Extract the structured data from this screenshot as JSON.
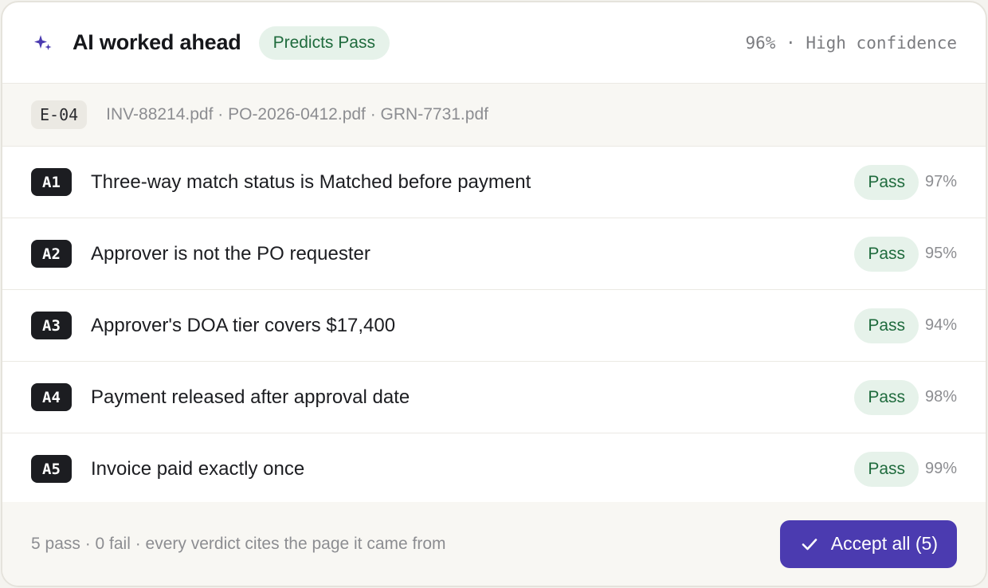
{
  "header": {
    "icon": "sparkle-icon",
    "title": "AI worked ahead",
    "badge": "Predicts Pass",
    "confidence": "96% · High confidence"
  },
  "evidence": {
    "id": "E-04",
    "files": "INV-88214.pdf · PO-2026-0412.pdf · GRN-7731.pdf"
  },
  "checks": [
    {
      "id": "A1",
      "text": "Three-way match status is Matched before payment",
      "verdict": "Pass",
      "pct": "97%"
    },
    {
      "id": "A2",
      "text": "Approver is not the PO requester",
      "verdict": "Pass",
      "pct": "95%"
    },
    {
      "id": "A3",
      "text": "Approver's DOA tier covers $17,400",
      "verdict": "Pass",
      "pct": "94%"
    },
    {
      "id": "A4",
      "text": "Payment released after approval date",
      "verdict": "Pass",
      "pct": "98%"
    },
    {
      "id": "A5",
      "text": "Invoice paid exactly once",
      "verdict": "Pass",
      "pct": "99%"
    }
  ],
  "footer": {
    "summary": "5 pass · 0 fail · every verdict cites the page it came from",
    "accept_label": "Accept all (5)",
    "accept_icon": "check-icon"
  },
  "colors": {
    "accent": "#4b3bb0",
    "pass_bg": "#e6f2ea",
    "pass_text": "#1f6b3d"
  }
}
